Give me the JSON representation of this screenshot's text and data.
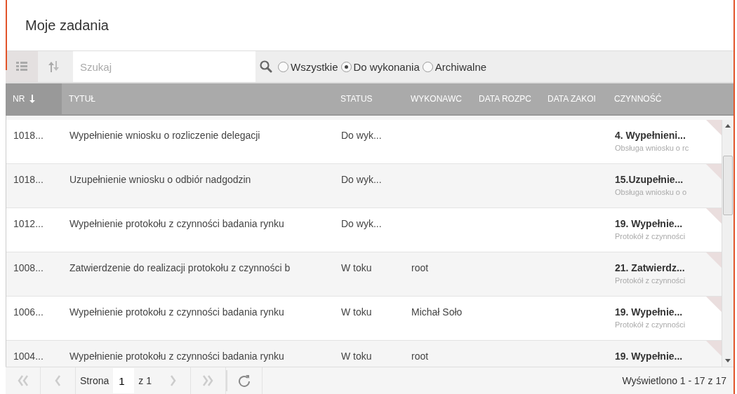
{
  "panel": {
    "title": "Moje zadania"
  },
  "toolbar": {
    "search": {
      "placeholder": "Szukaj"
    },
    "filters": [
      {
        "label": "Wszystkie",
        "selected": false
      },
      {
        "label": "Do wykonania",
        "selected": true
      },
      {
        "label": "Archiwalne",
        "selected": false
      }
    ]
  },
  "table": {
    "columns": [
      {
        "label": "NR",
        "sorted": true
      },
      {
        "label": "TYTUŁ",
        "sorted": false
      },
      {
        "label": "STATUS",
        "sorted": false
      },
      {
        "label": "WYKONAWC",
        "sorted": false
      },
      {
        "label": "DATA ROZPC",
        "sorted": false
      },
      {
        "label": "DATA ZAKOI",
        "sorted": false
      },
      {
        "label": "CZYNNOŚĆ",
        "sorted": false
      }
    ],
    "rows": [
      {
        "nr": "1018...",
        "title": "Wypełnienie wniosku o rozliczenie delegacji",
        "status": "Do wyk...",
        "assignee": "",
        "activity": "4. Wypełnieni...",
        "activity_sub": "Obsługa wniosku o rc"
      },
      {
        "nr": "1018...",
        "title": "Uzupełnienie wniosku o odbiór nadgodzin",
        "status": "Do wyk...",
        "assignee": "",
        "activity": "15.Uzupełnie...",
        "activity_sub": "Obsługa wniosku o o"
      },
      {
        "nr": "1012...",
        "title": "Wypełnienie protokołu z czynności badania rynku",
        "status": "Do wyk...",
        "assignee": "",
        "activity": "19. Wypełnie...",
        "activity_sub": "Protokół z czynności"
      },
      {
        "nr": "1008...",
        "title": "Zatwierdzenie do realizacji protokołu z czynności  b",
        "status": "W toku",
        "assignee": "root",
        "activity": "21. Zatwierdz...",
        "activity_sub": "Protokół z czynności"
      },
      {
        "nr": "1006...",
        "title": "Wypełnienie protokołu z czynności badania rynku",
        "status": "W toku",
        "assignee": "Michał Soło",
        "activity": "19. Wypełnie...",
        "activity_sub": "Protokół z czynności"
      },
      {
        "nr": "1004...",
        "title": "Wypełnienie protokołu z czynności badania rynku",
        "status": "W toku",
        "assignee": "root",
        "activity": "19. Wypełnie...",
        "activity_sub": ""
      }
    ]
  },
  "pager": {
    "page_label": "Strona",
    "page": "1",
    "of": "z 1",
    "summary": "Wyświetlono 1 - 17 z 17"
  }
}
